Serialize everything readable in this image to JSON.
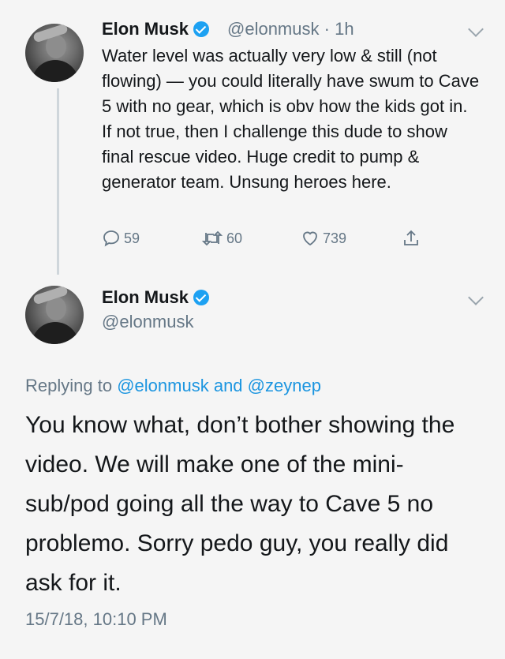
{
  "tweet1": {
    "name": "Elon Musk",
    "handle": "@elonmusk",
    "separator": "·",
    "time": "1h",
    "text": "Water level was actually very low & still (not flowing) — you could literally have swum to Cave 5 with no gear, which is obv how the kids got in. If not true, then I challenge this dude to show final rescue video. Huge credit to pump & generator team. Unsung heroes here.",
    "replies": "59",
    "retweets": "60",
    "likes": "739"
  },
  "tweet2": {
    "name": "Elon Musk",
    "handle": "@elonmusk",
    "replying_label": "Replying to",
    "reply_user1": "@elonmusk",
    "reply_and": "and",
    "reply_user2": "@zeynep",
    "text": "You know what, don’t bother showing the video. We will make one of the mini-sub/pod going all the way to Cave 5 no problemo. Sorry pedo guy, you really did ask for it.",
    "timestamp": "15/7/18, 10:10 PM"
  },
  "colors": {
    "link": "#1b95e0",
    "verified": "#1da1f2",
    "secondary_text": "#657786"
  },
  "icons": [
    "verified-badge-icon",
    "chevron-down-icon",
    "reply-icon",
    "retweet-icon",
    "like-icon",
    "share-icon"
  ]
}
